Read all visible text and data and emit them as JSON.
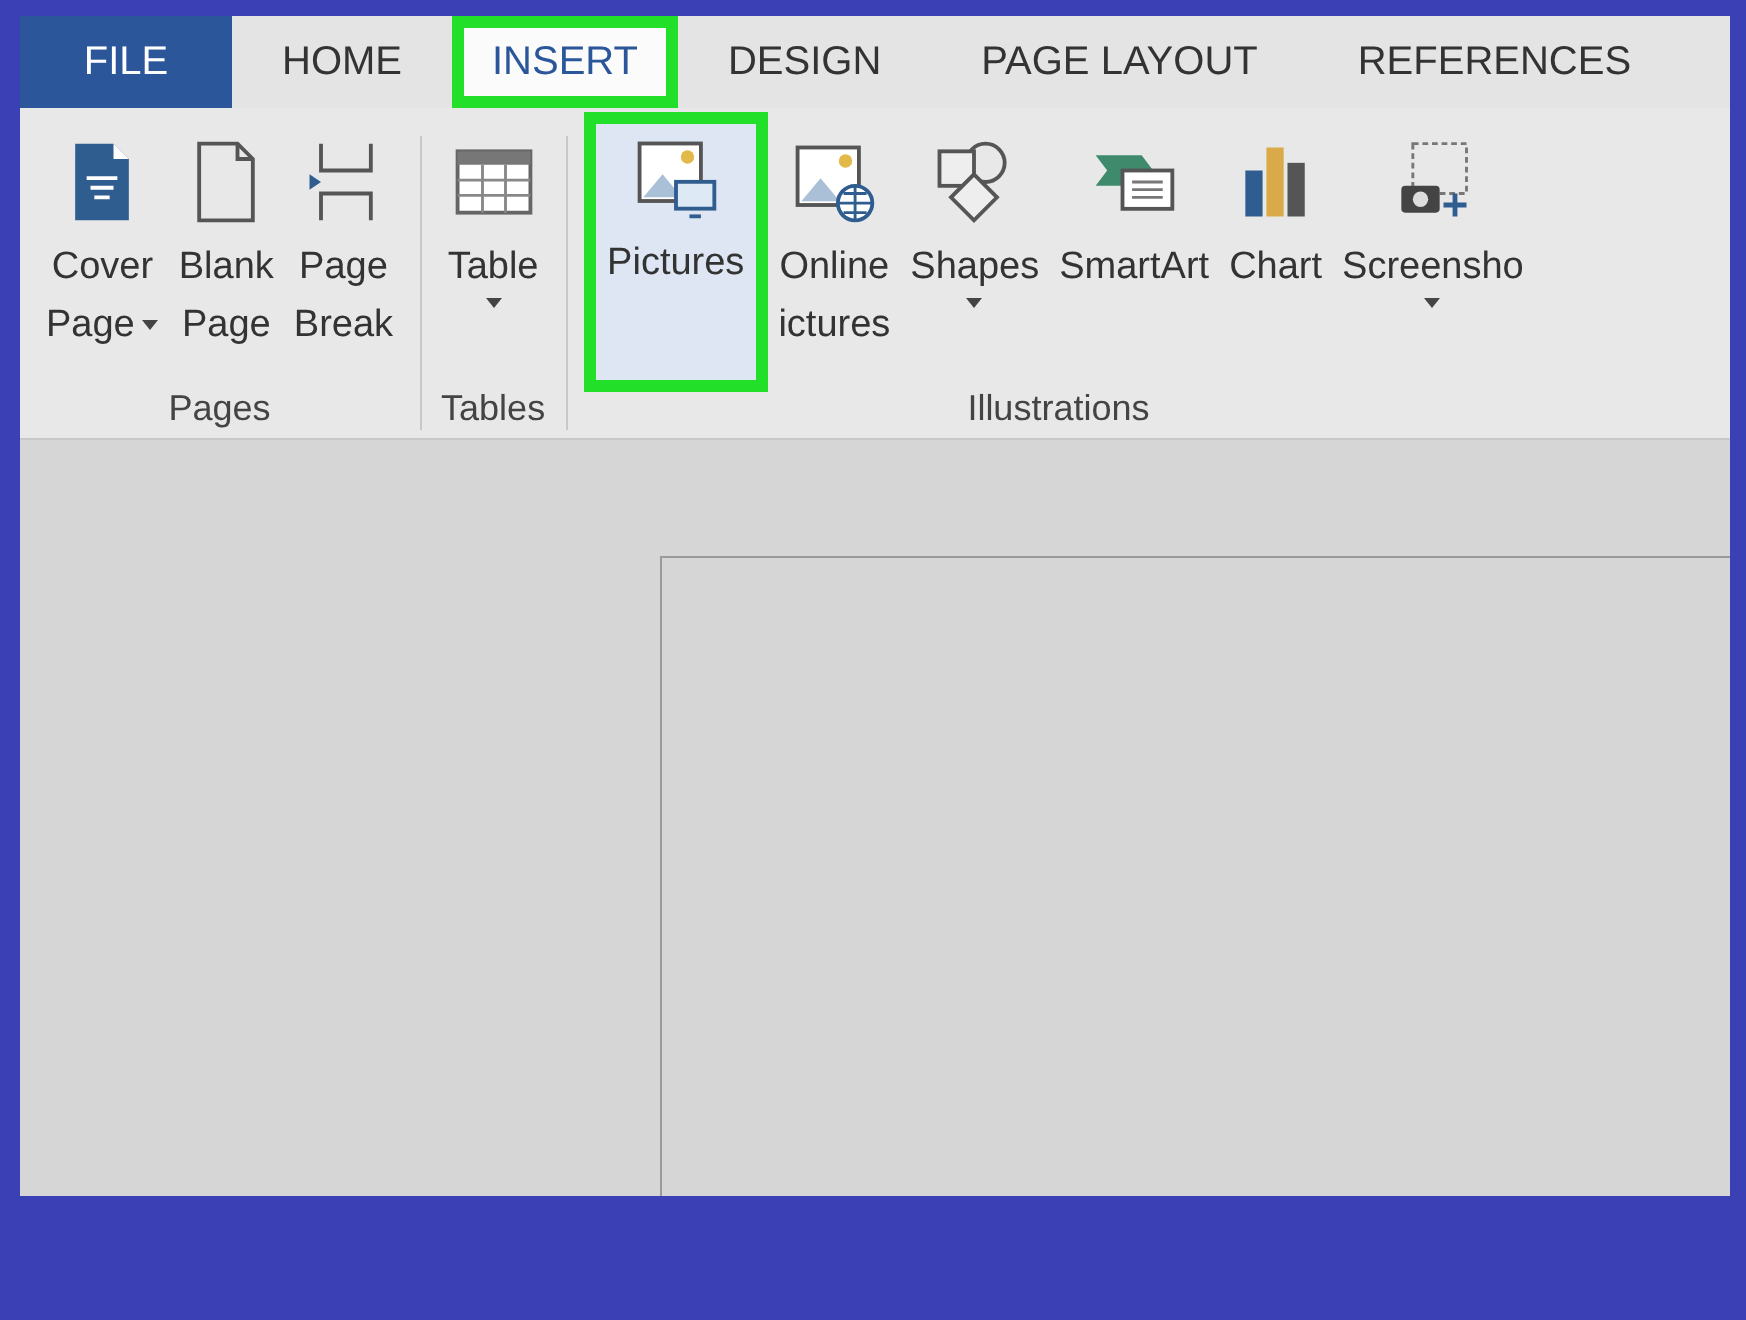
{
  "tabs": [
    {
      "label": "FILE",
      "kind": "file",
      "selected": false,
      "highlighted": false
    },
    {
      "label": "HOME",
      "kind": "tab",
      "selected": false,
      "highlighted": false
    },
    {
      "label": "INSERT",
      "kind": "tab",
      "selected": true,
      "highlighted": true
    },
    {
      "label": "DESIGN",
      "kind": "tab",
      "selected": false,
      "highlighted": false
    },
    {
      "label": "PAGE LAYOUT",
      "kind": "tab",
      "selected": false,
      "highlighted": false
    },
    {
      "label": "REFERENCES",
      "kind": "tab",
      "selected": false,
      "highlighted": false
    }
  ],
  "ribbon_groups": [
    {
      "label": "Pages",
      "buttons": [
        {
          "kind": "cover",
          "lines": [
            "Cover",
            "Page"
          ],
          "dropdown": true,
          "highlighted": false
        },
        {
          "kind": "blank",
          "lines": [
            "Blank",
            "Page"
          ],
          "dropdown": false,
          "highlighted": false
        },
        {
          "kind": "pagebreak",
          "lines": [
            "Page",
            "Break"
          ],
          "dropdown": false,
          "highlighted": false
        }
      ]
    },
    {
      "label": "Tables",
      "buttons": [
        {
          "kind": "table",
          "lines": [
            "Table"
          ],
          "dropdown": true,
          "highlighted": false
        }
      ]
    },
    {
      "label": "Illustrations",
      "buttons": [
        {
          "kind": "pictures",
          "lines": [
            "Pictures"
          ],
          "dropdown": false,
          "highlighted": true
        },
        {
          "kind": "online",
          "lines": [
            "Online",
            "ictures"
          ],
          "dropdown": false,
          "highlighted": false
        },
        {
          "kind": "shapes",
          "lines": [
            "Shapes"
          ],
          "dropdown": true,
          "highlighted": false
        },
        {
          "kind": "smartart",
          "lines": [
            "SmartArt"
          ],
          "dropdown": false,
          "highlighted": false
        },
        {
          "kind": "chart",
          "lines": [
            "Chart"
          ],
          "dropdown": false,
          "highlighted": false
        },
        {
          "kind": "screenshot",
          "lines": [
            "Screensho"
          ],
          "dropdown": true,
          "highlighted": false
        }
      ]
    }
  ]
}
